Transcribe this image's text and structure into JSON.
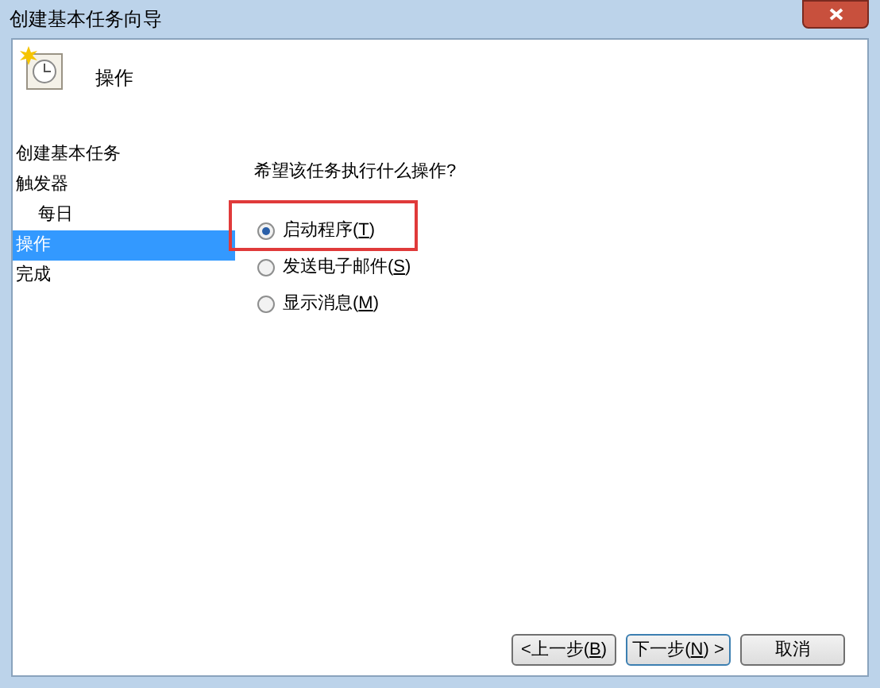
{
  "window": {
    "title": "创建基本任务向导"
  },
  "header": {
    "title": "操作"
  },
  "steps": [
    {
      "label": "创建基本任务",
      "selected": false
    },
    {
      "label": "触发器",
      "selected": false,
      "children": [
        {
          "label": "每日",
          "selected": false
        }
      ]
    },
    {
      "label": "操作",
      "selected": true
    },
    {
      "label": "完成",
      "selected": false
    }
  ],
  "question": "希望该任务执行什么操作?",
  "options": [
    {
      "before": "启动程序(",
      "key": "T",
      "after": ")",
      "selected": true,
      "highlighted": true
    },
    {
      "before": "发送电子邮件(",
      "key": "S",
      "after": ")",
      "selected": false,
      "highlighted": false
    },
    {
      "before": "显示消息(",
      "key": "M",
      "after": ")",
      "selected": false,
      "highlighted": false
    }
  ],
  "buttons": [
    {
      "before": "<上一步(",
      "key": "B",
      "after": ")",
      "default": false
    },
    {
      "before": "下一步(",
      "key": "N",
      "after": ") >",
      "default": true
    },
    {
      "before": "取消",
      "default": false
    }
  ]
}
